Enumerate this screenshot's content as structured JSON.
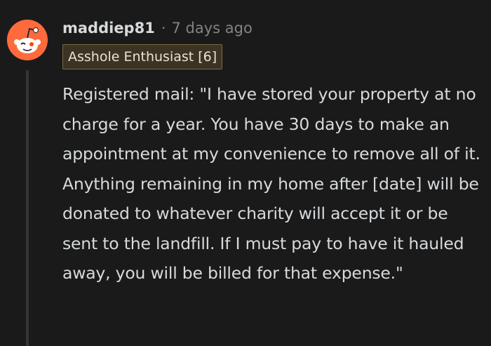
{
  "comment": {
    "username": "maddiep81",
    "separator": "·",
    "timestamp": "7 days ago",
    "flair": "Asshole Enthusiast [6]",
    "body": "Registered mail: \"I have stored your property at no charge for a year. You have 30 days to make an appointment at my convenience to remove all of it. Anything remaining in my home after [date] will be donated to whatever charity will accept it or be sent to the landfill. If I must pay to have it hauled away, you will be billed for that expense.\"",
    "avatar_icon": "snoo-avatar-icon"
  },
  "colors": {
    "background": "#1a1a1b",
    "text": "#d7dadc",
    "meta": "#818384",
    "avatar": "#ff6a3d",
    "flair_bg": "#3c3324"
  }
}
